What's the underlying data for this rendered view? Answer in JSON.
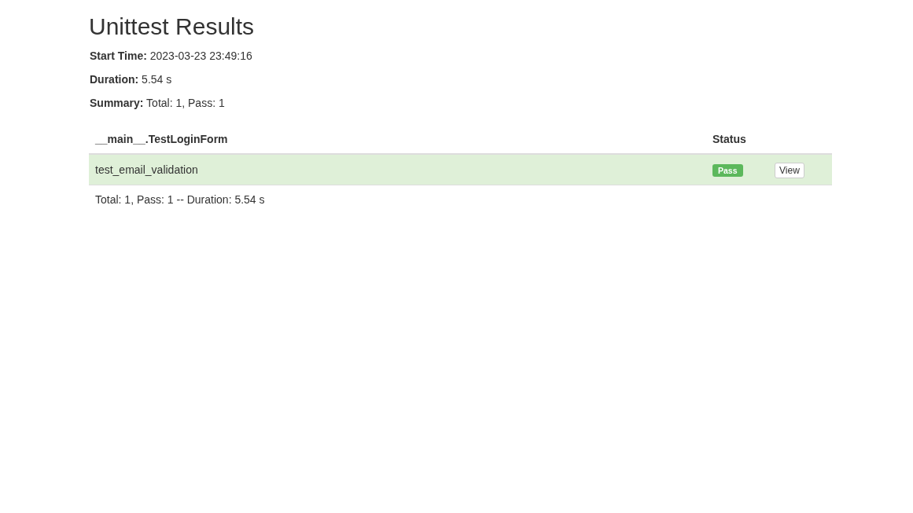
{
  "title": "Unittest Results",
  "info": [
    {
      "label": "Start Time:",
      "value": "2023-03-23 23:49:16"
    },
    {
      "label": "Duration:",
      "value": "5.54 s"
    },
    {
      "label": "Summary:",
      "value": "Total: 1, Pass: 1"
    }
  ],
  "table": {
    "columns": [
      "__main__.TestLoginForm",
      "Status"
    ],
    "rows": [
      {
        "name": "test_email_validation",
        "status": "Pass",
        "kind": "pass",
        "action": "View"
      }
    ],
    "footer": "Total: 1, Pass: 1 -- Duration: 5.54 s"
  }
}
